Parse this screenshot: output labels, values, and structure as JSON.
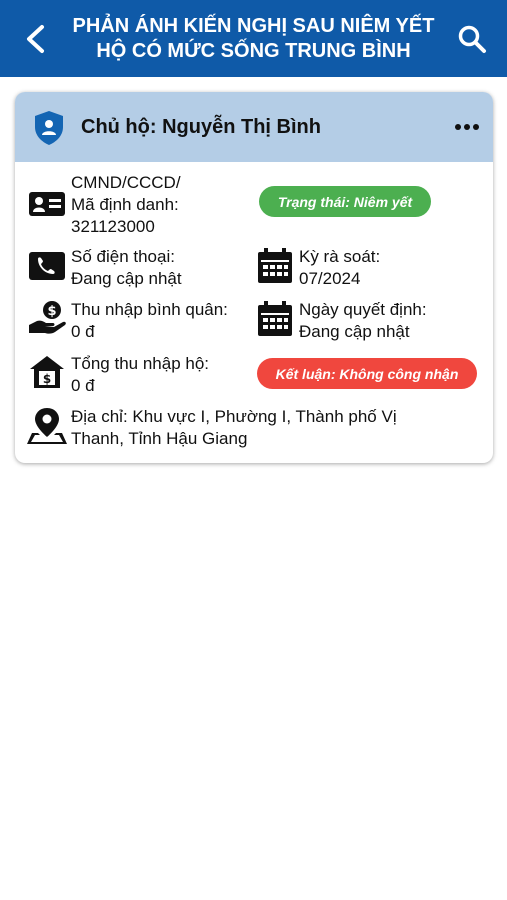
{
  "header": {
    "title_line1": "PHẢN ÁNH KIẾN NGHỊ SAU NIÊM YẾT",
    "title_line2": "HỘ CÓ MỨC SỐNG TRUNG BÌNH",
    "back_icon": "chevron-left-icon",
    "search_icon": "search-icon",
    "color": "#0f5aa8"
  },
  "card": {
    "owner": "Chủ hộ: Nguyễn Thị Bình",
    "header_color": "#b4cde6",
    "id_label": "CMND/CCCD/",
    "id_label2": "Mã định danh:",
    "id_value": "321123000",
    "status_badge": "Trạng thái: Niêm yết",
    "status_color": "#4caf50",
    "phone_label": "Số điện thoại:",
    "phone_value": "Đang cập nhật",
    "review_label": "Kỳ rà soát:",
    "review_value": "07/2024",
    "avg_income_label": "Thu nhập bình quân:",
    "avg_income_value": "0 đ",
    "decision_label": "Ngày quyết định:",
    "decision_value": "Đang cập nhật",
    "total_income_label": "Tổng thu nhập hộ:",
    "total_income_value": "0 đ",
    "conclusion_badge": "Kết luận: Không công nhận",
    "conclusion_color": "#f0473e",
    "address_line1": "Địa chỉ: Khu vực I, Phường I, Thành phố Vị",
    "address_line2": "Thanh, Tỉnh Hậu Giang"
  }
}
